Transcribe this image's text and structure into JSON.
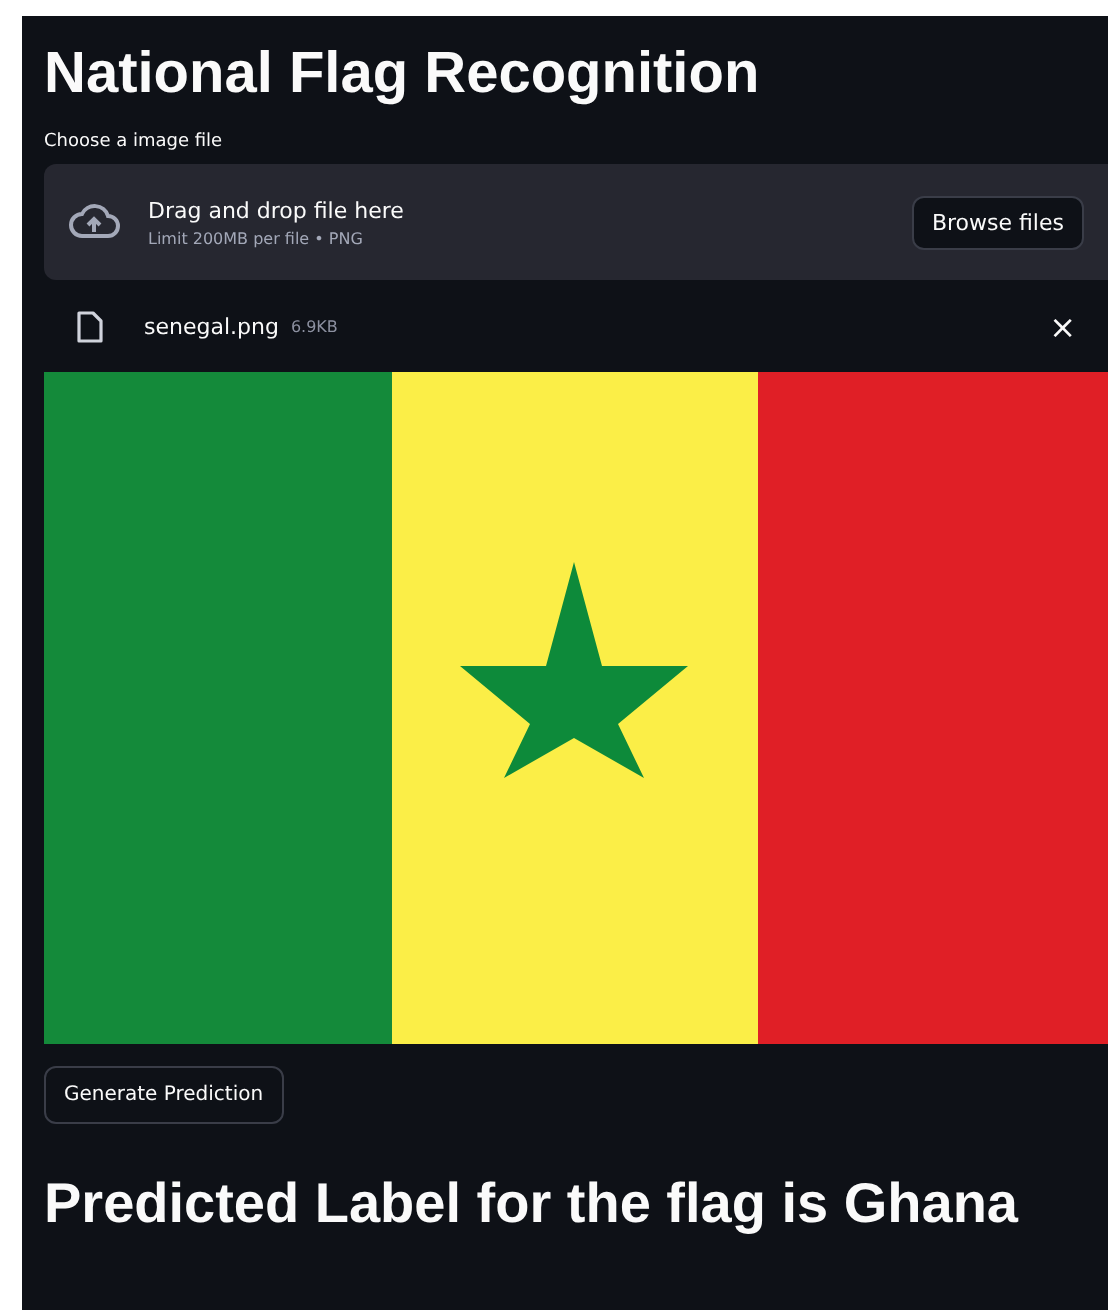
{
  "title": "National Flag Recognition",
  "uploader": {
    "label": "Choose a image file",
    "drop_text": "Drag and drop file here",
    "limit_text": "Limit 200MB per file • PNG",
    "browse_button": "Browse files"
  },
  "file": {
    "name": "senegal.png",
    "size": "6.9KB",
    "remove": "×"
  },
  "button": "Generate Prediction",
  "result": "Predicted Label for the flag is Ghana"
}
